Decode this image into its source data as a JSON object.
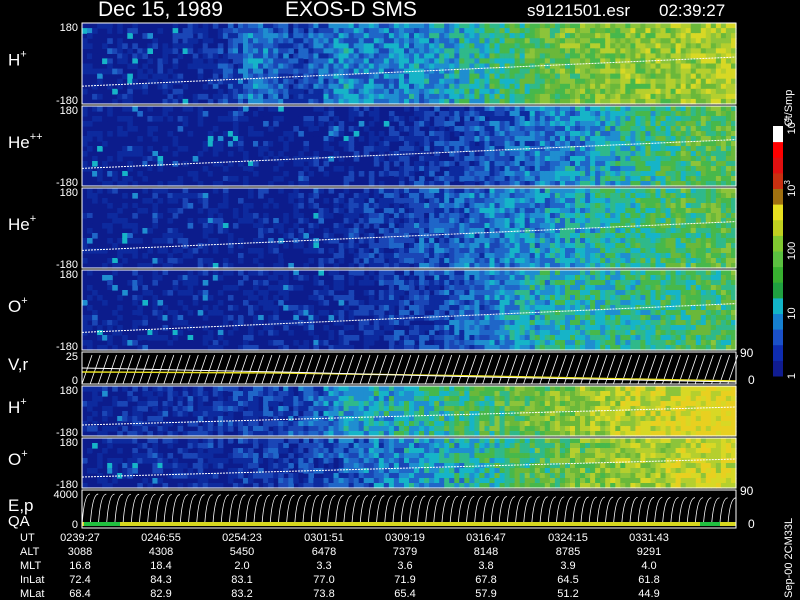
{
  "header": {
    "date": "Dec 15, 1989",
    "instrument": "EXOS-D SMS",
    "file": "s9121501.esr",
    "time": "02:39:27"
  },
  "chart_data": {
    "type": "heatmap",
    "panels": [
      {
        "label": "H",
        "sup": "+",
        "ymax": "180",
        "ymin": "-180",
        "profile": [
          0.02,
          0.05,
          0.05,
          0.1,
          0.3,
          0.15,
          0.35,
          0.3,
          0.35,
          0.45,
          0.55,
          0.65,
          0.7,
          0.72,
          0.75,
          0.78
        ]
      },
      {
        "label": "He",
        "sup": "++",
        "ymax": "180",
        "ymin": "-180",
        "profile": [
          0.02,
          0.02,
          0.02,
          0.02,
          0.02,
          0.03,
          0.05,
          0.08,
          0.12,
          0.18,
          0.25,
          0.32,
          0.4,
          0.5,
          0.58,
          0.62
        ]
      },
      {
        "label": "He",
        "sup": "+",
        "ymax": "180",
        "ymin": "-180",
        "profile": [
          0.02,
          0.02,
          0.03,
          0.05,
          0.05,
          0.06,
          0.1,
          0.15,
          0.2,
          0.26,
          0.32,
          0.38,
          0.45,
          0.52,
          0.58,
          0.62
        ]
      },
      {
        "label": "O",
        "sup": "+",
        "ymax": "180",
        "ymin": "-180",
        "profile": [
          0.02,
          0.02,
          0.03,
          0.03,
          0.05,
          0.05,
          0.08,
          0.12,
          0.16,
          0.25,
          0.4,
          0.45,
          0.45,
          0.5,
          0.55,
          0.58
        ]
      },
      {
        "label": "V,r",
        "sup": "",
        "ymax": "25",
        "ymin": "0",
        "right_top": "90",
        "right_bottom": "0"
      },
      {
        "label": "H",
        "sup": "+",
        "ymax": "180",
        "ymin": "-180",
        "profile": [
          0.05,
          0.08,
          0.1,
          0.12,
          0.15,
          0.2,
          0.35,
          0.42,
          0.48,
          0.55,
          0.62,
          0.7,
          0.78,
          0.85,
          0.9,
          0.95
        ]
      },
      {
        "label": "O",
        "sup": "+",
        "ymax": "180",
        "ymin": "-180",
        "profile": [
          0.03,
          0.05,
          0.08,
          0.1,
          0.12,
          0.15,
          0.22,
          0.3,
          0.38,
          0.46,
          0.55,
          0.62,
          0.7,
          0.78,
          0.85,
          0.9
        ]
      },
      {
        "label": "E,p",
        "sup": "",
        "label2": "QA",
        "ymax": "4000",
        "ymin": "0",
        "right_top": "90",
        "right_bottom": "0"
      }
    ],
    "colorbar": {
      "unit": "Ct/Smp",
      "ticks": [
        {
          "text": "1",
          "pos": 0.0
        },
        {
          "text": "10",
          "pos": 0.25
        },
        {
          "text": "100",
          "pos": 0.5
        },
        {
          "text": "10",
          "sup": "3",
          "pos": 0.75
        },
        {
          "text": "10",
          "sup": "4",
          "pos": 1.0
        }
      ]
    },
    "footer_labels": [
      "UT",
      "ALT",
      "MLT",
      "InLat",
      "MLat"
    ],
    "footer_columns": [
      {
        "UT": "0239:27",
        "ALT": "3088",
        "MLT": "16.8",
        "InLat": "72.4",
        "MLat": "68.4"
      },
      {
        "UT": "0246:55",
        "ALT": "4308",
        "MLT": "18.4",
        "InLat": "84.3",
        "MLat": "82.9"
      },
      {
        "UT": "0254:23",
        "ALT": "5450",
        "MLT": "2.0",
        "InLat": "83.1",
        "MLat": "83.2"
      },
      {
        "UT": "0301:51",
        "ALT": "6478",
        "MLT": "3.3",
        "InLat": "77.0",
        "MLat": "73.8"
      },
      {
        "UT": "0309:19",
        "ALT": "7379",
        "MLT": "3.6",
        "InLat": "71.9",
        "MLat": "65.4"
      },
      {
        "UT": "0316:47",
        "ALT": "8148",
        "MLT": "3.8",
        "InLat": "67.8",
        "MLat": "57.9"
      },
      {
        "UT": "0324:15",
        "ALT": "8785",
        "MLT": "3.9",
        "InLat": "64.5",
        "MLat": "51.2"
      },
      {
        "UT": "0331:43",
        "ALT": "9291",
        "MLT": "4.0",
        "InLat": "61.8",
        "MLat": "44.9"
      }
    ],
    "side_label": "Sep-00 2CM33L"
  }
}
